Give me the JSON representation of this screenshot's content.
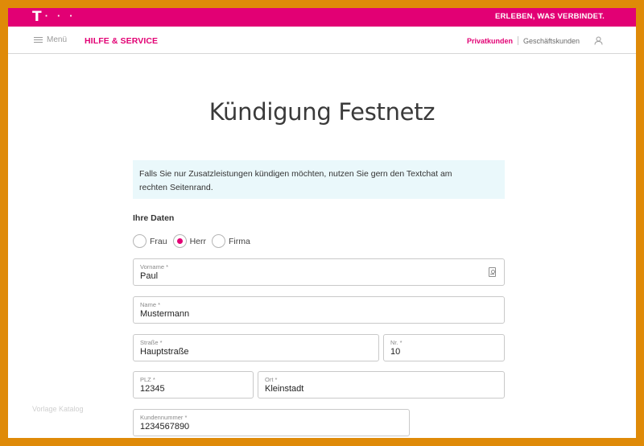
{
  "header": {
    "logo_text": "T",
    "logo_dots": "· · ·",
    "slogan": "ERLEBEN, WAS VERBINDET.",
    "brand_color": "#e20074"
  },
  "nav": {
    "menu_label": "Menü",
    "menu_icon": "hamburger-icon",
    "brand": "HILFE & SERVICE",
    "private": "Privatkunden",
    "business": "Geschäftskunden",
    "user_icon": "user-icon"
  },
  "page": {
    "title": "Kündigung Festnetz",
    "info_line1": "Falls Sie nur Zusatzleistungen kündigen möchten, nutzen Sie gern den Textchat am",
    "info_line2": "rechten Seitenrand.",
    "info_bg": "#eaf8fb",
    "section_label": "Ihre Daten"
  },
  "salutation": {
    "options": [
      "Frau",
      "Herr",
      "Firma"
    ],
    "selected": "Herr"
  },
  "form": {
    "vorname": {
      "label": "Vorname *",
      "value": "Paul"
    },
    "name": {
      "label": "Name *",
      "value": "Mustermann"
    },
    "strasse": {
      "label": "Straße *",
      "value": "Hauptstraße"
    },
    "nr": {
      "label": "Nr. *",
      "value": "10"
    },
    "plz": {
      "label": "PLZ *",
      "value": "12345"
    },
    "ort": {
      "label": "Ort *",
      "value": "Kleinstadt"
    },
    "kundennummer": {
      "label": "Kundennummer *",
      "value": "1234567890"
    }
  },
  "watermark": "Vorlage Katalog"
}
